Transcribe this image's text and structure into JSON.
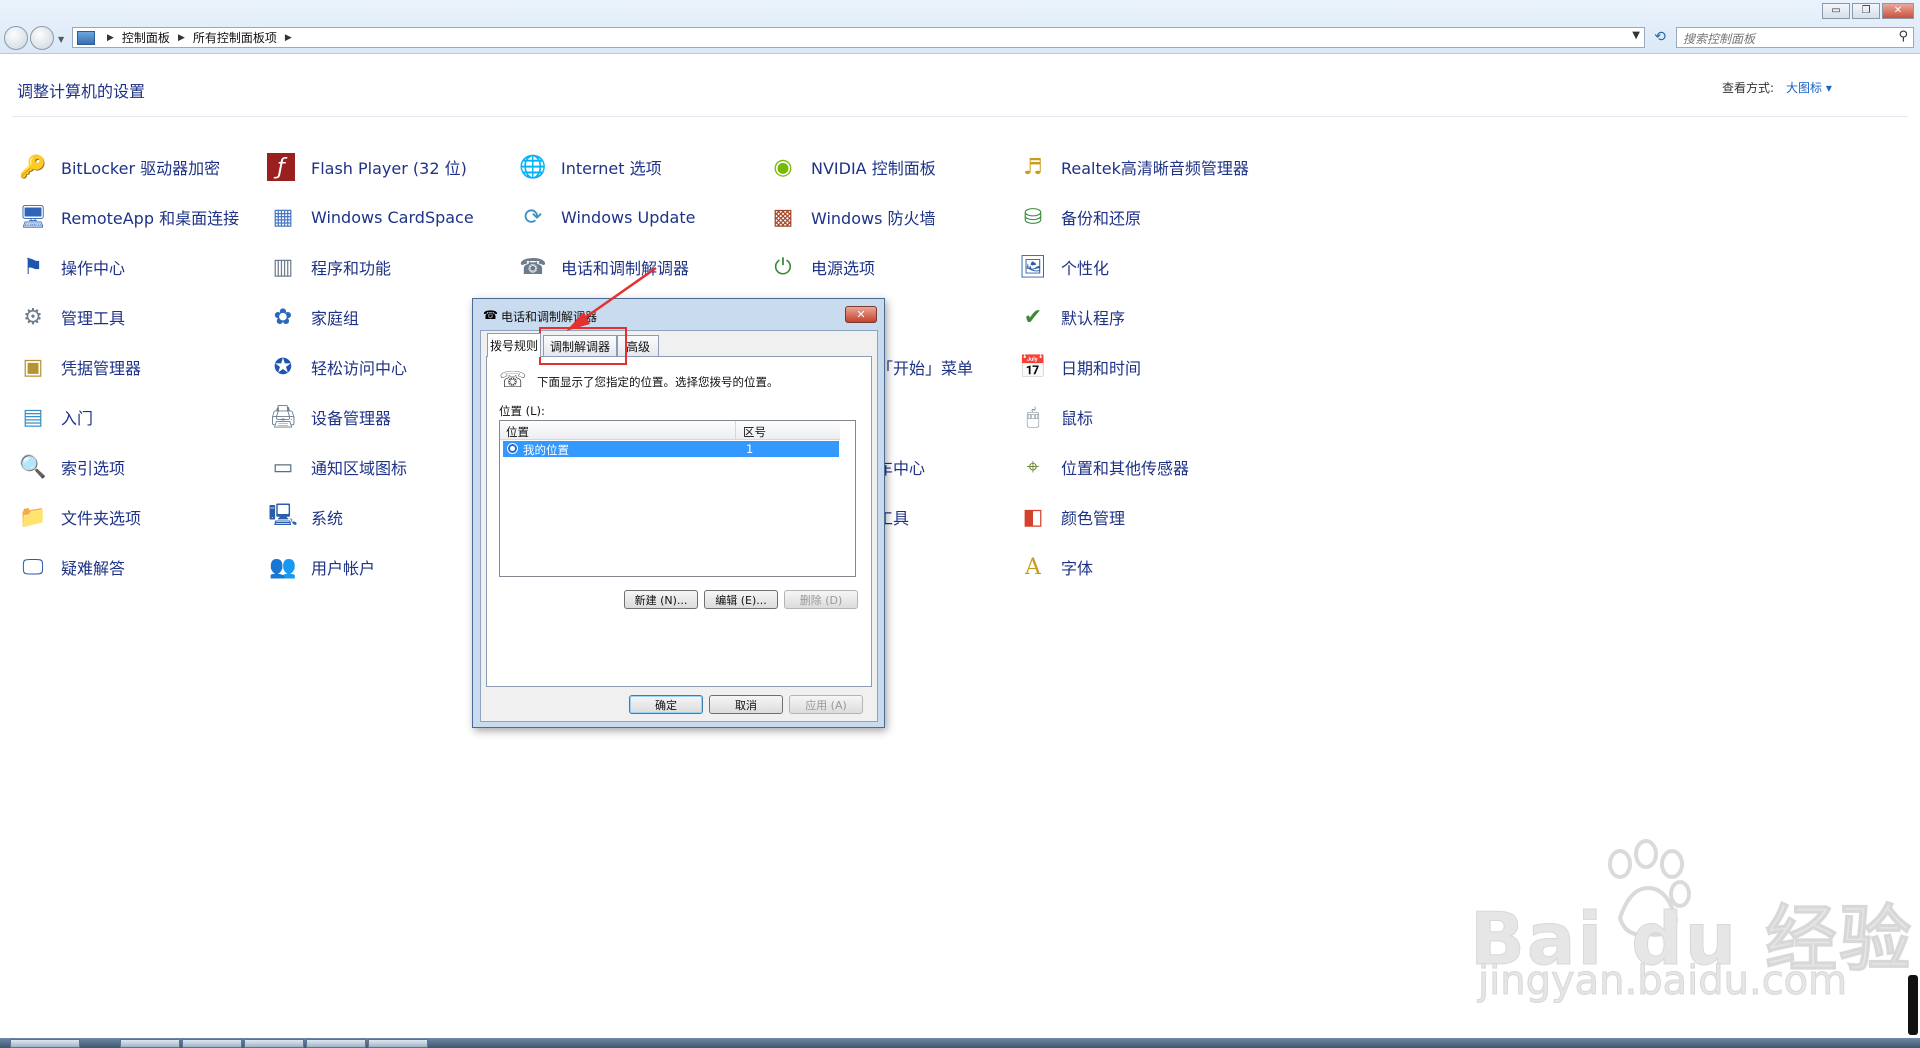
{
  "window": {
    "breadcrumb": [
      "控制面板",
      "所有控制面板项"
    ],
    "search_placeholder": "搜索控制面板",
    "controls": {
      "minimize": "▭",
      "maximize": "❐",
      "close": "✕"
    }
  },
  "header": {
    "title": "调整计算机的设置",
    "view_label": "查看方式:",
    "view_value": "大图标 ▾"
  },
  "items": [
    {
      "label": "BitLocker 驱动器加密",
      "icon": "key-lock-icon"
    },
    {
      "label": "RemoteApp 和桌面连接",
      "icon": "remote-desktop-icon"
    },
    {
      "label": "操作中心",
      "icon": "flag-icon"
    },
    {
      "label": "管理工具",
      "icon": "admin-tools-icon"
    },
    {
      "label": "凭据管理器",
      "icon": "credential-vault-icon"
    },
    {
      "label": "入门",
      "icon": "getting-started-icon"
    },
    {
      "label": "索引选项",
      "icon": "magnifier-icon"
    },
    {
      "label": "文件夹选项",
      "icon": "folder-icon"
    },
    {
      "label": "疑难解答",
      "icon": "troubleshoot-monitor-icon"
    },
    {
      "label": "Flash Player (32 位)",
      "icon": "flash-icon"
    },
    {
      "label": "Windows CardSpace",
      "icon": "cardspace-icon"
    },
    {
      "label": "程序和功能",
      "icon": "programs-icon"
    },
    {
      "label": "家庭组",
      "icon": "homegroup-icon"
    },
    {
      "label": "轻松访问中心",
      "icon": "accessibility-icon"
    },
    {
      "label": "设备管理器",
      "icon": "device-manager-icon"
    },
    {
      "label": "通知区域图标",
      "icon": "notification-tray-icon"
    },
    {
      "label": "系统",
      "icon": "system-monitor-icon"
    },
    {
      "label": "用户帐户",
      "icon": "users-icon"
    },
    {
      "label": "Internet 选项",
      "icon": "globe-icon"
    },
    {
      "label": "Windows Update",
      "icon": "windows-update-icon"
    },
    {
      "label": "电话和调制解调器",
      "icon": "phone-modem-icon"
    },
    {
      "label": "NVIDIA 控制面板",
      "icon": "nvidia-icon"
    },
    {
      "label": "Windows 防火墙",
      "icon": "firewall-icon"
    },
    {
      "label": "电源选项",
      "icon": "power-icon"
    },
    {
      "label": "「开始」菜单",
      "icon": "start-menu-icon"
    },
    {
      "label": "车中心",
      "icon": "sync-center-icon"
    },
    {
      "label": "工具",
      "icon": "tools-icon"
    },
    {
      "label": "Realtek高清晰音频管理器",
      "icon": "audio-manager-icon"
    },
    {
      "label": "备份和还原",
      "icon": "backup-icon"
    },
    {
      "label": "个性化",
      "icon": "personalize-icon"
    },
    {
      "label": "默认程序",
      "icon": "default-programs-icon"
    },
    {
      "label": "日期和时间",
      "icon": "calendar-clock-icon"
    },
    {
      "label": "鼠标",
      "icon": "mouse-icon"
    },
    {
      "label": "位置和其他传感器",
      "icon": "sensor-icon"
    },
    {
      "label": "颜色管理",
      "icon": "color-management-icon"
    },
    {
      "label": "字体",
      "icon": "font-icon"
    }
  ],
  "dialog": {
    "title": "电话和调制解调器",
    "close": "✕",
    "tabs": [
      "拨号规则",
      "调制解调器",
      "高级"
    ],
    "description": "下面显示了您指定的位置。选择您拨号的位置。",
    "locations_label": "位置 (L):",
    "columns": [
      "位置",
      "区号"
    ],
    "rows": [
      {
        "location": "我的位置",
        "area_code": "1"
      }
    ],
    "buttons": {
      "new": "新建 (N)...",
      "edit": "编辑 (E)...",
      "delete": "删除 (D)",
      "ok": "确定",
      "cancel": "取消",
      "apply": "应用 (A)"
    }
  },
  "watermark": {
    "brand": "Bai du 经验",
    "url": "jingyan.baidu.com"
  },
  "colors": {
    "link": "#1e3287",
    "highlight": "#e53030",
    "selection": "#3399ff"
  }
}
